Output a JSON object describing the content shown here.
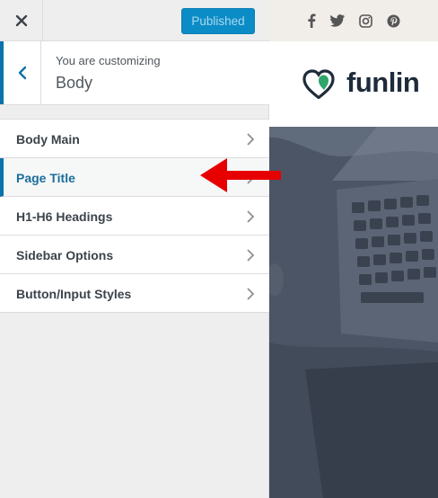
{
  "topbar": {
    "close_icon": "close-icon",
    "publish_label": "Published"
  },
  "section": {
    "customizing_label": "You are customizing",
    "title": "Body"
  },
  "menu": {
    "items": [
      {
        "label": "Body Main",
        "active": false
      },
      {
        "label": "Page Title",
        "active": true
      },
      {
        "label": "H1-H6 Headings",
        "active": false
      },
      {
        "label": "Sidebar Options",
        "active": false
      },
      {
        "label": "Button/Input Styles",
        "active": false
      }
    ]
  },
  "preview": {
    "social_icons": [
      "facebook-icon",
      "twitter-icon",
      "instagram-icon",
      "pinterest-icon"
    ],
    "logo_text": "funlin"
  },
  "colors": {
    "accent": "#0b73aa",
    "publish_bg": "#0b8cc6",
    "logo_green": "#2ea56b",
    "logo_dark": "#1e2b3a",
    "annotation_arrow": "#e60000"
  }
}
